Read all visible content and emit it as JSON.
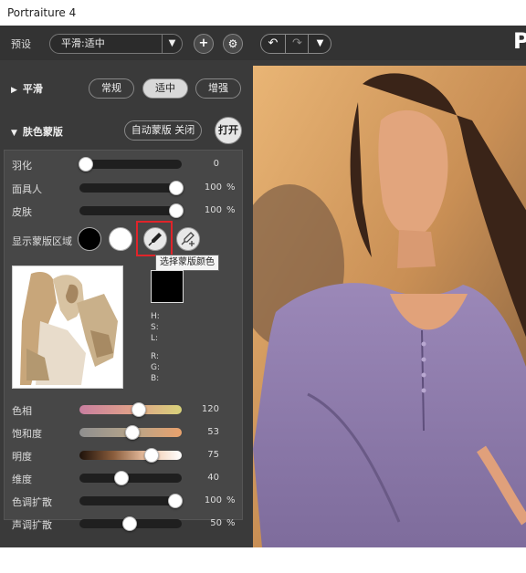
{
  "window": {
    "title": "Portraiture 4"
  },
  "toolbar": {
    "preset_label": "预设",
    "preset_value": "平滑:适中",
    "add_icon": "plus-icon",
    "settings_icon": "gear-icon",
    "logo_text": "P"
  },
  "smoothing": {
    "title": "平滑",
    "options": [
      "常规",
      "适中",
      "增强"
    ],
    "selected": "适中"
  },
  "skin_mask": {
    "title": "肤色蒙版",
    "auto_mask_label": "自动蒙版 关闭",
    "open_label": "打开",
    "sliders": [
      {
        "label": "羽化",
        "value": "0",
        "unit": "",
        "fraction": 0.0
      },
      {
        "label": "面具人",
        "value": "100",
        "unit": "%",
        "fraction": 1.0
      },
      {
        "label": "皮肤",
        "value": "100",
        "unit": "%",
        "fraction": 1.0
      }
    ],
    "show_mask_label": "显示蒙版区域",
    "tooltip": "选择蒙版颜色",
    "hsl_labels": [
      "H:",
      "S:",
      "L:"
    ],
    "rgb_labels": [
      "R:",
      "G:",
      "B:"
    ],
    "mask_color": "#000000"
  },
  "adjust_sliders": [
    {
      "label": "色相",
      "value": "120",
      "unit": "",
      "fraction": 0.59,
      "track": "hue"
    },
    {
      "label": "饱和度",
      "value": "53",
      "unit": "",
      "fraction": 0.52,
      "track": "sat"
    },
    {
      "label": "明度",
      "value": "75",
      "unit": "",
      "fraction": 0.73,
      "track": "lum"
    },
    {
      "label": "维度",
      "value": "40",
      "unit": "",
      "fraction": 0.4,
      "track": "dark"
    },
    {
      "label": "色调扩散",
      "value": "100",
      "unit": "%",
      "fraction": 1.0,
      "track": "dark"
    },
    {
      "label": "声调扩散",
      "value": "50",
      "unit": "%",
      "fraction": 0.49,
      "track": "dark"
    }
  ],
  "colors": {
    "highlight": "#e0242a",
    "panel": "#3a3a3a"
  }
}
